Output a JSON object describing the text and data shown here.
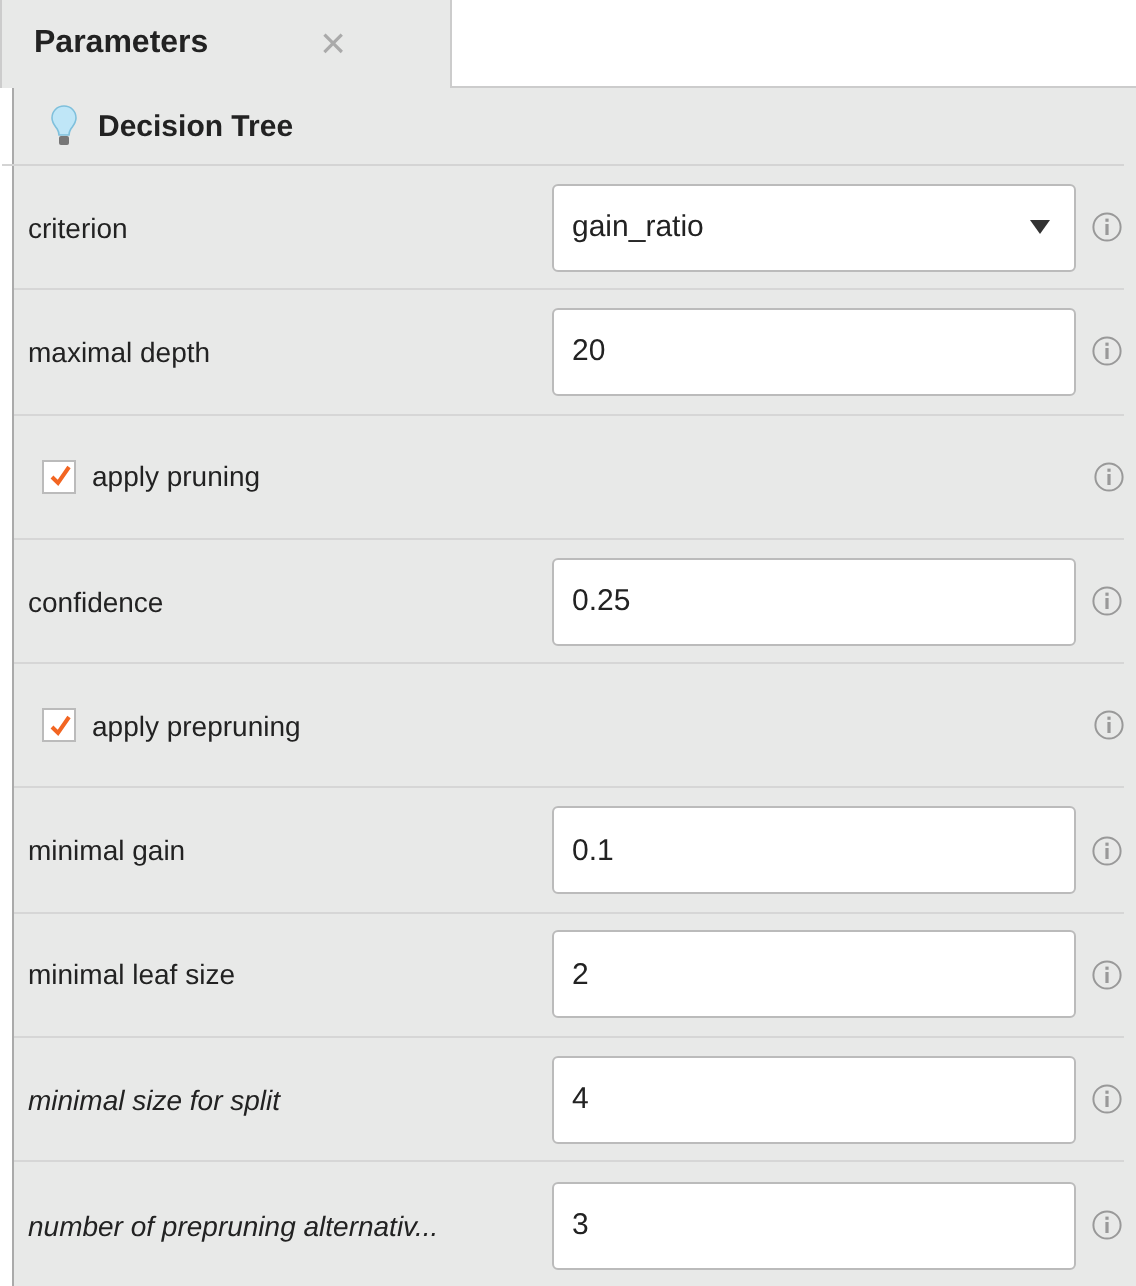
{
  "tabs": [
    {
      "label": "Parameters",
      "selected": true,
      "close": "×"
    }
  ],
  "operator": {
    "title": "Decision Tree"
  },
  "parameters": [
    {
      "kind": "select",
      "label": "criterion",
      "value": "gain_ratio",
      "expert": false
    },
    {
      "kind": "field",
      "label": "maximal depth",
      "value": "20",
      "expert": false
    },
    {
      "kind": "checkbox",
      "label": "apply pruning",
      "checked": true,
      "expert": false
    },
    {
      "kind": "field",
      "label": "confidence",
      "value": "0.25",
      "expert": false
    },
    {
      "kind": "checkbox",
      "label": "apply prepruning",
      "checked": true,
      "expert": false
    },
    {
      "kind": "field",
      "label": "minimal gain",
      "value": "0.1",
      "expert": false
    },
    {
      "kind": "field",
      "label": "minimal leaf size",
      "value": "2",
      "expert": false
    },
    {
      "kind": "field",
      "label": "minimal size for split",
      "value": "4",
      "expert": true
    },
    {
      "kind": "field",
      "label": "number of prepruning alternativ...",
      "value": "3",
      "expert": true
    }
  ]
}
